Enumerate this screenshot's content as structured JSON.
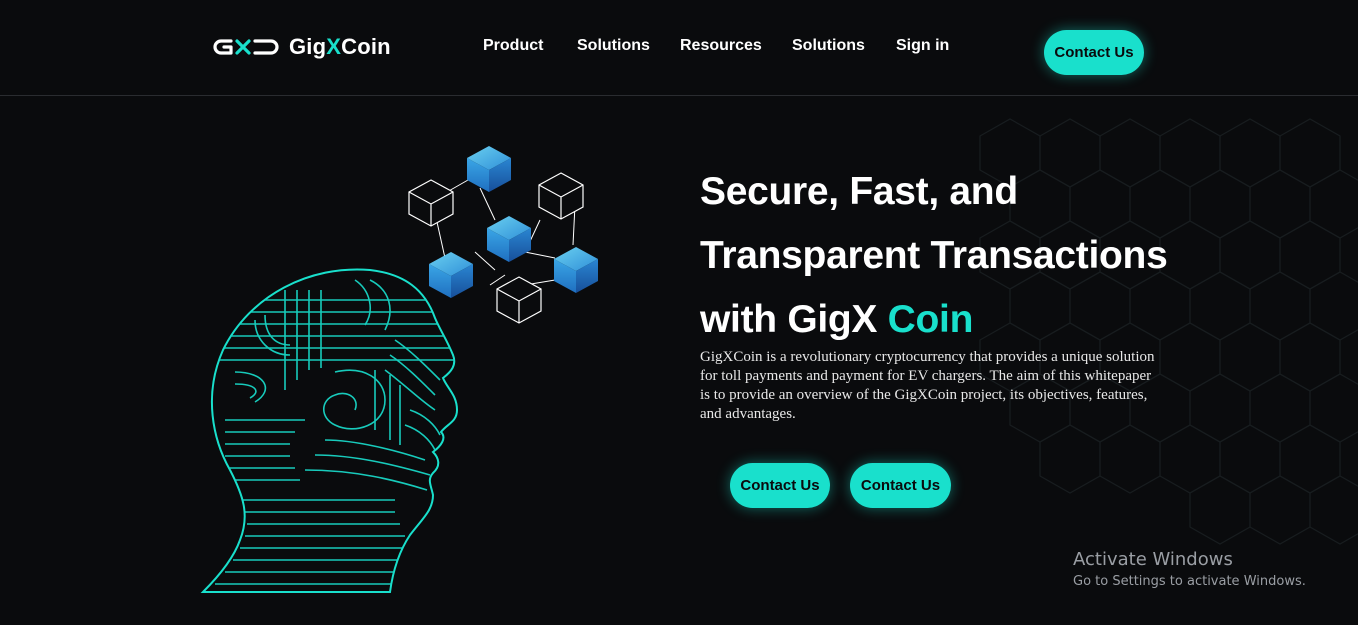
{
  "header": {
    "logo_mark": "GXC",
    "logo_text_prefix": "Gig",
    "logo_text_x": "X",
    "logo_text_suffix": "Coin",
    "nav": [
      {
        "label": "Product"
      },
      {
        "label": "Solutions"
      },
      {
        "label": "Resources"
      },
      {
        "label": "Solutions"
      },
      {
        "label": "Sign in"
      }
    ],
    "cta_label": "Contact Us"
  },
  "hero": {
    "title_line1": "Secure, Fast, and",
    "title_line2": "Transparent Transactions",
    "title_line3_prefix": "with GigX ",
    "title_line3_accent": "Coin",
    "description": "GigXCoin is a revolutionary cryptocurrency that provides a unique solution for toll payments and payment for EV chargers. The aim of this whitepaper is to provide an overview of the GigXCoin project, its objectives, features, and advantages.",
    "primary_button": "Contact Us",
    "secondary_button": "Contact Us",
    "illustration": "head-with-blockchain-cubes"
  },
  "system": {
    "watermark_title": "Activate Windows",
    "watermark_subtitle": "Go to Settings to activate Windows."
  },
  "colors": {
    "background": "#0a0b0d",
    "accent": "#19e0cc",
    "text": "#ffffff",
    "cube_blue": "#2f8fd8"
  }
}
